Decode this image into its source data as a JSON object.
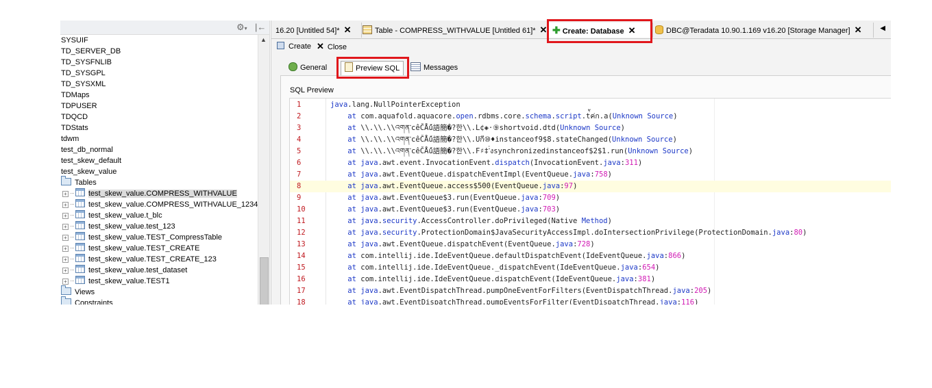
{
  "colors": {
    "highlight_box": "#e0161b",
    "line_number": "#c0191f",
    "keyword": "#1c38c7",
    "number": "#d11ab4",
    "current_line": "#fffde0"
  },
  "left_panel": {
    "toolbar_icons": [
      "gear-icon",
      "collapse-icon"
    ],
    "scroll_up_glyph": "▲",
    "nodes": [
      {
        "label": "SYSUIF",
        "kind": "db"
      },
      {
        "label": "TD_SERVER_DB",
        "kind": "db"
      },
      {
        "label": "TD_SYSFNLIB",
        "kind": "db"
      },
      {
        "label": "TD_SYSGPL",
        "kind": "db"
      },
      {
        "label": "TD_SYSXML",
        "kind": "db"
      },
      {
        "label": "TDMaps",
        "kind": "db"
      },
      {
        "label": "TDPUSER",
        "kind": "db"
      },
      {
        "label": "TDQCD",
        "kind": "db"
      },
      {
        "label": "TDStats",
        "kind": "db"
      },
      {
        "label": "tdwm",
        "kind": "db"
      },
      {
        "label": "test_db_normal",
        "kind": "db"
      },
      {
        "label": "test_skew_default",
        "kind": "db"
      },
      {
        "label": "test_skew_value",
        "kind": "db"
      },
      {
        "label": "Tables",
        "kind": "folder"
      },
      {
        "label": "test_skew_value.COMPRESS_WITHVALUE",
        "kind": "table",
        "selected": true
      },
      {
        "label": "test_skew_value.COMPRESS_WITHVALUE_1234",
        "kind": "table"
      },
      {
        "label": "test_skew_value.t_blc",
        "kind": "table"
      },
      {
        "label": "test_skew_value.test_123",
        "kind": "table"
      },
      {
        "label": "test_skew_value.TEST_CompressTable",
        "kind": "table"
      },
      {
        "label": "test_skew_value.TEST_CREATE",
        "kind": "table"
      },
      {
        "label": "test_skew_value.TEST_CREATE_123",
        "kind": "table"
      },
      {
        "label": "test_skew_value.test_dataset",
        "kind": "table"
      },
      {
        "label": "test_skew_value.TEST1",
        "kind": "table"
      },
      {
        "label": "Views",
        "kind": "folder"
      },
      {
        "label": "Constraints",
        "kind": "folder"
      }
    ]
  },
  "editor_tabs": [
    {
      "label": "16.20 [Untitled 54]*",
      "close": "✕",
      "icon": "none"
    },
    {
      "label": "Table - COMPRESS_WITHVALUE [Untitled 61]*",
      "close": "✕",
      "icon": "table-icon"
    },
    {
      "label": "Create: Database",
      "close": "✕",
      "icon": "plus-icon",
      "active": true
    },
    {
      "label": "DBC@Teradata 10.90.1.169 v16.20 [Storage Manager]",
      "close": "✕",
      "icon": "database-icon"
    }
  ],
  "tab_scroll_arrow": "◀",
  "actions": {
    "create": "Create",
    "close": "Close",
    "close_glyph": "✕"
  },
  "subtabs": [
    {
      "label": "General",
      "icon": "general-icon"
    },
    {
      "label": "Preview SQL",
      "icon": "preview-icon",
      "active": true
    },
    {
      "label": "Messages",
      "icon": "messages-icon"
    }
  ],
  "sql_preview": {
    "title": "SQL Preview",
    "highlighted_line": 8,
    "lines": [
      {
        "n": "1",
        "text": "java.lang.NullPointerException"
      },
      {
        "n": "2",
        "text": "    at com.aquafold.aquacore.open.rdbms.core.schema.script.t่้ค่ก.a(Unknown Source)"
      },
      {
        "n": "3",
        "text": "    at \\\\.\\\\.\\\\འགན་cêČǺű語簡�?한\\\\.L¢◈·⑨shortvoid.dtd(Unknown Source)"
      },
      {
        "n": "4",
        "text": "    at \\\\.\\\\.\\\\འགན་cêČǺű語簡�?한\\\\.Uกี⑩♦instanceof9$8.stateChanged(Unknown Source)"
      },
      {
        "n": "5",
        "text": "    at \\\\.\\\\.\\\\འགན་cêČǺű語簡�?한\\\\.F♯‡་่งsynchronizedinstanceof$2$1.run(Unknown Source)"
      },
      {
        "n": "6",
        "text": "    at java.awt.event.InvocationEvent.dispatch(InvocationEvent.java:311)"
      },
      {
        "n": "7",
        "text": "    at java.awt.EventQueue.dispatchEventImpl(EventQueue.java:758)"
      },
      {
        "n": "8",
        "text": "    at java.awt.EventQueue.access$500(EventQueue.java:97)"
      },
      {
        "n": "9",
        "text": "    at java.awt.EventQueue$3.run(EventQueue.java:709)"
      },
      {
        "n": "10",
        "text": "    at java.awt.EventQueue$3.run(EventQueue.java:703)"
      },
      {
        "n": "11",
        "text": "    at java.security.AccessController.doPrivileged(Native Method)"
      },
      {
        "n": "12",
        "text": "    at java.security.ProtectionDomain$JavaSecurityAccessImpl.doIntersectionPrivilege(ProtectionDomain.java:80)"
      },
      {
        "n": "13",
        "text": "    at java.awt.EventQueue.dispatchEvent(EventQueue.java:728)"
      },
      {
        "n": "14",
        "text": "    at com.intellij.ide.IdeEventQueue.defaultDispatchEvent(IdeEventQueue.java:866)"
      },
      {
        "n": "15",
        "text": "    at com.intellij.ide.IdeEventQueue._dispatchEvent(IdeEventQueue.java:654)"
      },
      {
        "n": "16",
        "text": "    at com.intellij.ide.IdeEventQueue.dispatchEvent(IdeEventQueue.java:381)"
      },
      {
        "n": "17",
        "text": "    at java.awt.EventDispatchThread.pumpOneEventForFilters(EventDispatchThread.java:205)"
      },
      {
        "n": "18",
        "text": "    at java.awt.EventDispatchThread.pumpEventsForFilter(EventDispatchThread.java:116)"
      }
    ]
  }
}
